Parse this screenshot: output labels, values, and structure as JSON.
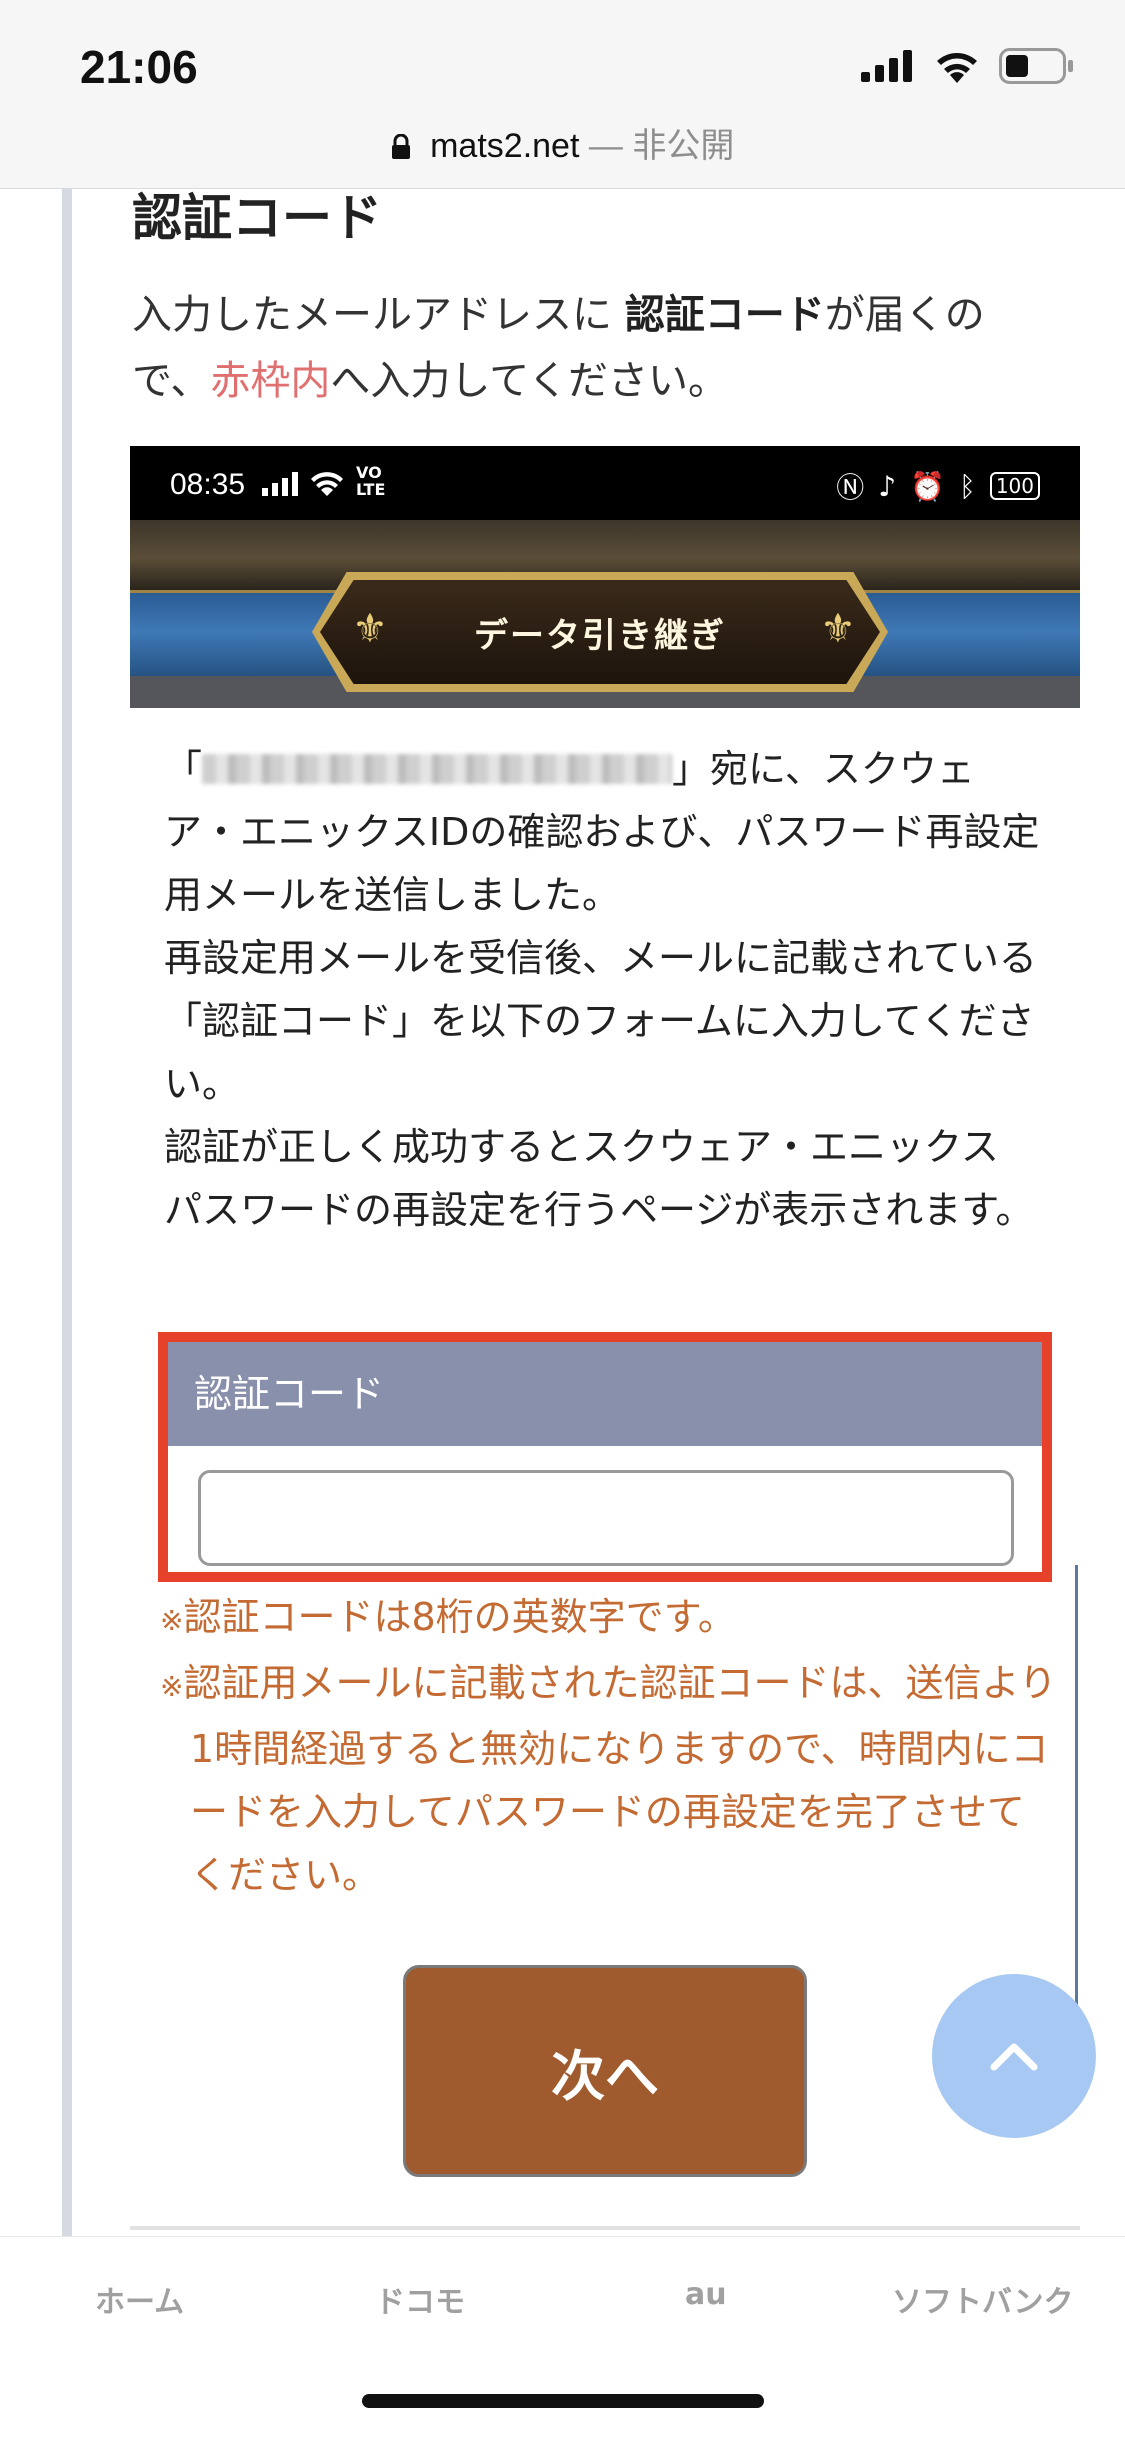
{
  "status_bar": {
    "time": "21:06"
  },
  "url_bar": {
    "domain": "mats2.net",
    "separator": "—",
    "privacy": "非公開"
  },
  "article": {
    "heading": "認証コード",
    "intro_part1": "入力したメールアドレスに ",
    "intro_bold": "認証コード",
    "intro_part2": "が届くので、",
    "intro_red": "赤枠内",
    "intro_part3": "へ入力してください。"
  },
  "screenshot": {
    "time": "08:35",
    "battery": "100",
    "title": "データ引き継ぎ",
    "msg_open": "「",
    "msg_after_email": "」宛に、スクウェア・エニックスIDの確認および、パスワード再設定用メールを送信しました。",
    "msg_line2": "再設定用メールを受信後、メールに記載されている「認証コード」を以下のフォームに入力してください。",
    "msg_line3": "認証が正しく成功するとスクウェア・エニックス パスワードの再設定を行うページが表示されます。",
    "form_label": "認証コード",
    "input_value": "",
    "note1": "認証コードは8桁の英数字です。",
    "note2": "認証用メールに記載された認証コードは、送信より1時間経過すると無効になりますので、時間内にコードを入力してパスワードの再設定を完了させてください。",
    "note_mark": "※",
    "next_label": "次へ"
  },
  "tabs": [
    "ホーム",
    "ドコモ",
    "au",
    "ソフトバンク"
  ],
  "colors": {
    "accent_red": "#e6412b",
    "note_orange": "#c46a33",
    "button_brown": "#9f5a2d",
    "form_header": "#8890ab",
    "to_top": "#a6c8f2"
  }
}
